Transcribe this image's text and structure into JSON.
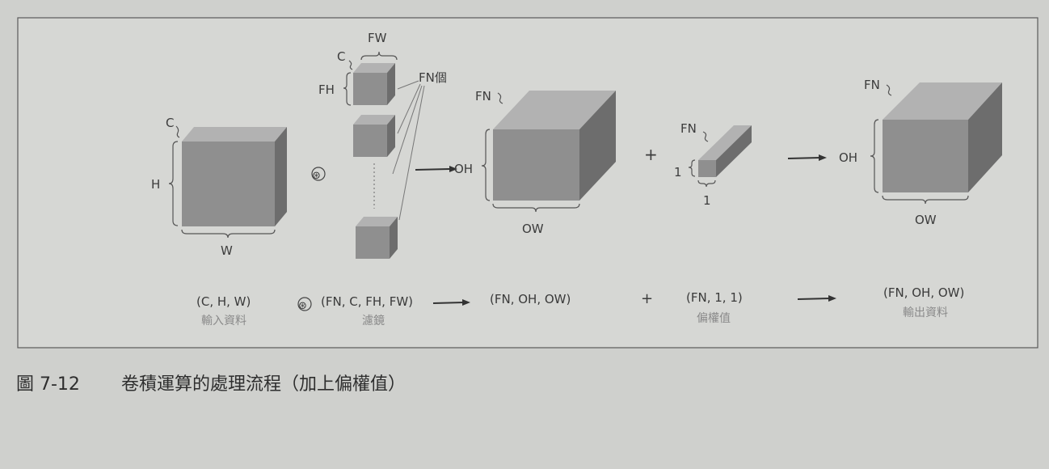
{
  "figure": {
    "number": "圖 7-12",
    "title": "卷積運算的處理流程（加上偏權值）"
  },
  "diagram": {
    "input": {
      "c": "C",
      "h": "H",
      "w": "W"
    },
    "filter": {
      "fw": "FW",
      "c": "C",
      "fh": "FH",
      "count": "FN個"
    },
    "conv_out": {
      "fn": "FN",
      "oh": "OH",
      "ow": "OW"
    },
    "bias": {
      "fn": "FN",
      "one_h": "1",
      "one_w": "1"
    },
    "output": {
      "fn": "FN",
      "oh": "OH",
      "ow": "OW"
    },
    "conv_symbol": "⊛",
    "plus": "+"
  },
  "captions": {
    "input_shape": "(C, H, W)",
    "input_name": "輸入資料",
    "filter_shape": "(FN, C, FH, FW)",
    "filter_name": "濾鏡",
    "conv_shape": "(FN, OH, OW)",
    "bias_shape": "(FN, 1, 1)",
    "bias_name": "偏權值",
    "output_shape": "(FN, OH, OW)",
    "output_name": "輸出資料"
  },
  "colors": {
    "background": "#cfd0cd",
    "cube_front": "#8f8f8f",
    "cube_top": "#b2b2b2",
    "cube_side": "#6d6d6d"
  }
}
